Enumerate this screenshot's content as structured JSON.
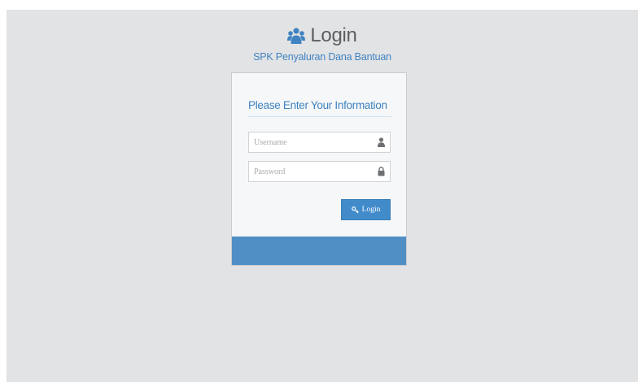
{
  "header": {
    "title": "Login",
    "subtitle": "SPK Penyaluran Dana Bantuan",
    "icon": "users-icon",
    "icon_color": "#3f83c1"
  },
  "form": {
    "heading": "Please Enter Your Information",
    "username": {
      "placeholder": "Username",
      "value": "",
      "icon": "user-icon"
    },
    "password": {
      "placeholder": "Password",
      "value": "",
      "icon": "lock-icon"
    },
    "submit_label": "Login",
    "submit_icon": "key-icon"
  },
  "colors": {
    "accent": "#418bca",
    "footer_band": "#4f8fc6",
    "background": "#e2e3e5"
  }
}
